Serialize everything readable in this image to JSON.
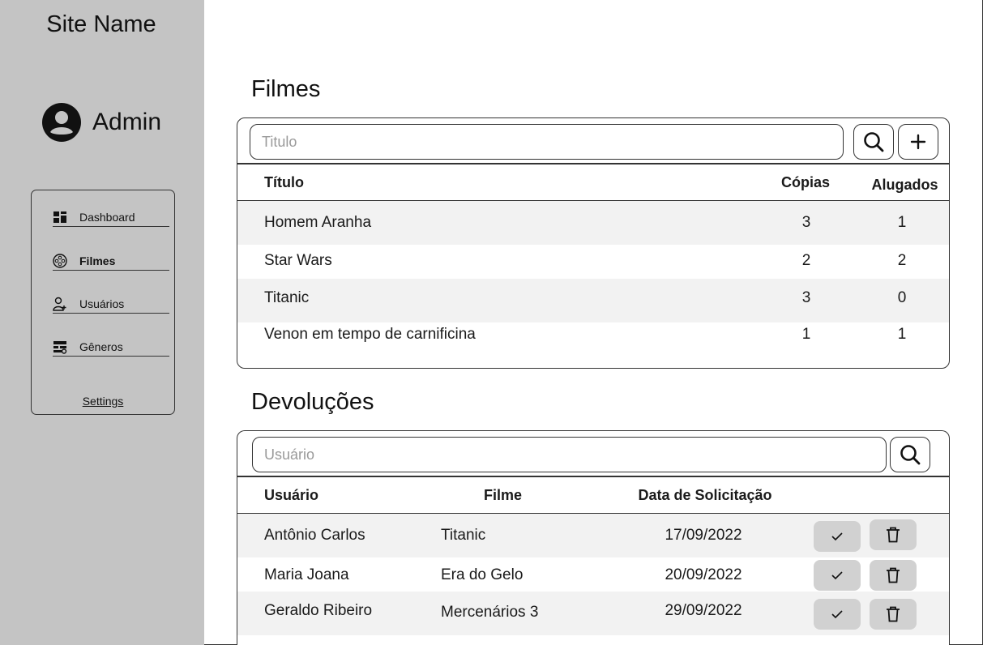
{
  "sidebar": {
    "site_name": "Site Name",
    "user_name": "Admin",
    "nav": [
      {
        "label": "Dashboard",
        "icon": "dashboard-icon"
      },
      {
        "label": "Filmes",
        "icon": "film-reel-icon",
        "active": true
      },
      {
        "label": "Usuários",
        "icon": "add-user-icon"
      },
      {
        "label": "Gêneros",
        "icon": "genres-icon"
      }
    ],
    "settings_label": "Settings"
  },
  "filmes": {
    "title": "Filmes",
    "search_placeholder": "Titulo",
    "columns": [
      "Título",
      "Cópias",
      "Alugados"
    ],
    "rows": [
      {
        "titulo": "Homem Aranha",
        "copias": "3",
        "alugados": "1"
      },
      {
        "titulo": "Star Wars",
        "copias": "2",
        "alugados": "2"
      },
      {
        "titulo": "Titanic",
        "copias": "3",
        "alugados": "0"
      },
      {
        "titulo": "Venon em tempo de carnificina",
        "copias": "1",
        "alugados": "1"
      }
    ]
  },
  "devolucoes": {
    "title": "Devoluções",
    "search_placeholder": "Usuário",
    "columns": [
      "Usuário",
      "Filme",
      "Data de Solicitação"
    ],
    "rows": [
      {
        "usuario": "Antônio Carlos",
        "filme": "Titanic",
        "data": "17/09/2022"
      },
      {
        "usuario": "Maria Joana",
        "filme": "Era do Gelo",
        "data": "20/09/2022"
      },
      {
        "usuario": "Geraldo Ribeiro",
        "filme": "Mercenários 3",
        "data": "29/09/2022"
      }
    ]
  },
  "colors": {
    "sidebar_bg": "#c4c4c4",
    "row_alt": "#f2f2f2",
    "action_btn": "#d1d1d1"
  }
}
